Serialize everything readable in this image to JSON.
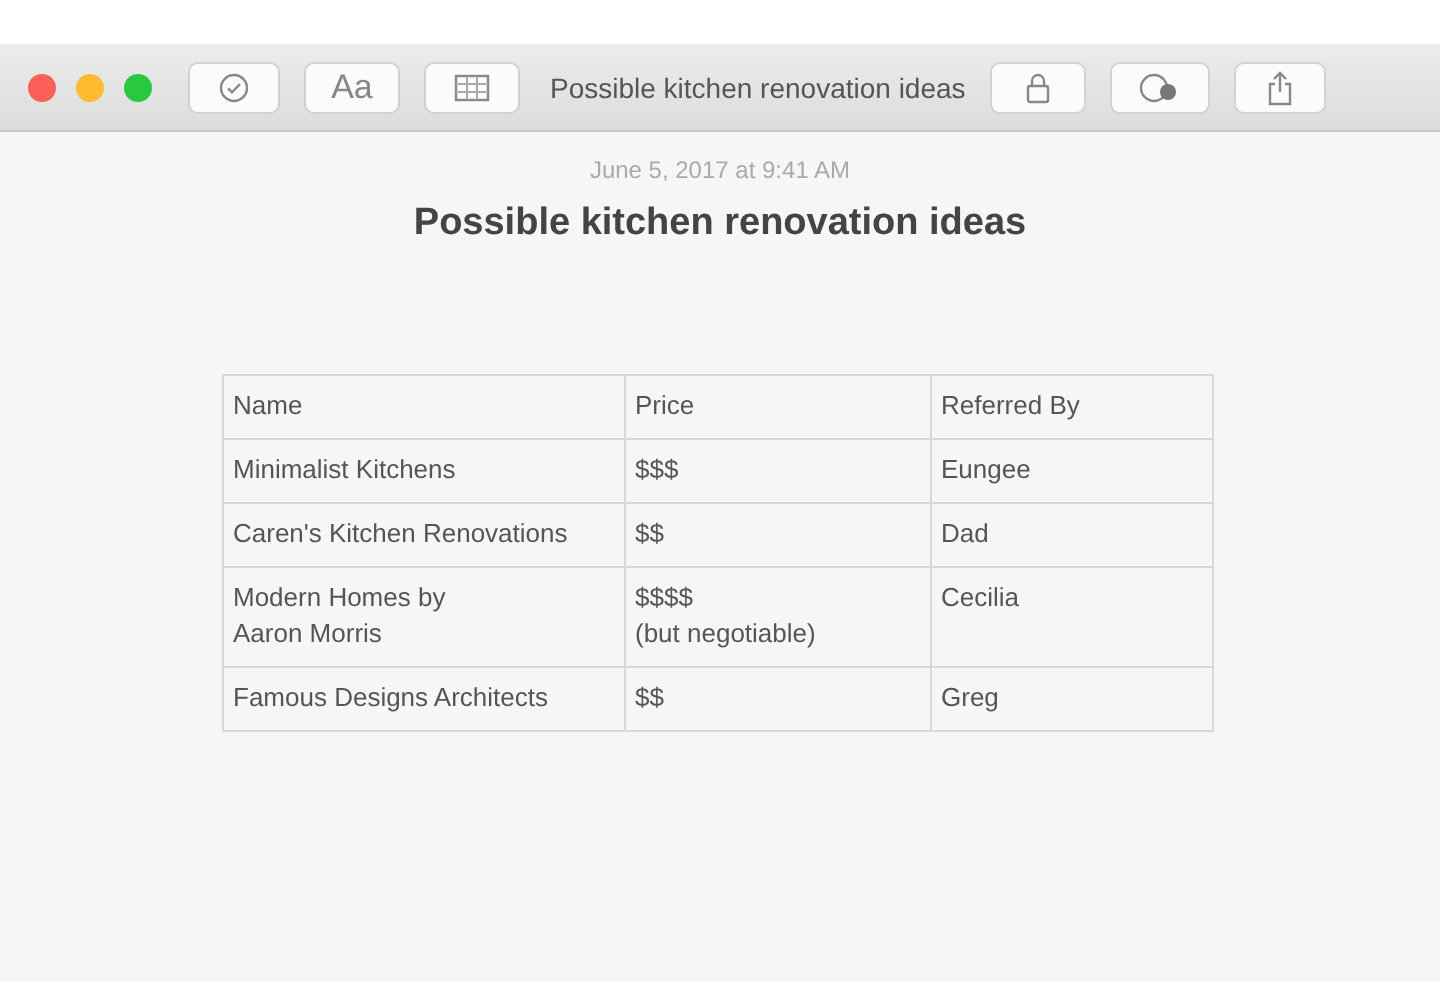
{
  "window": {
    "title": "Possible kitchen renovation ideas"
  },
  "toolbar": {
    "format_button": "Aa"
  },
  "note": {
    "date": "June 5, 2017 at 9:41 AM",
    "heading": "Possible kitchen renovation ideas",
    "table": {
      "columns": [
        "Name",
        "Price",
        "Referred By"
      ],
      "rows": [
        [
          "Minimalist Kitchens",
          "$$$",
          "Eungee"
        ],
        [
          "Caren's Kitchen Renovations",
          "$$",
          "Dad"
        ],
        [
          "Modern Homes by\nAaron Morris",
          "$$$$\n(but negotiable)",
          "Cecilia"
        ],
        [
          "Famous Designs Architects",
          "$$",
          "Greg"
        ]
      ]
    }
  }
}
